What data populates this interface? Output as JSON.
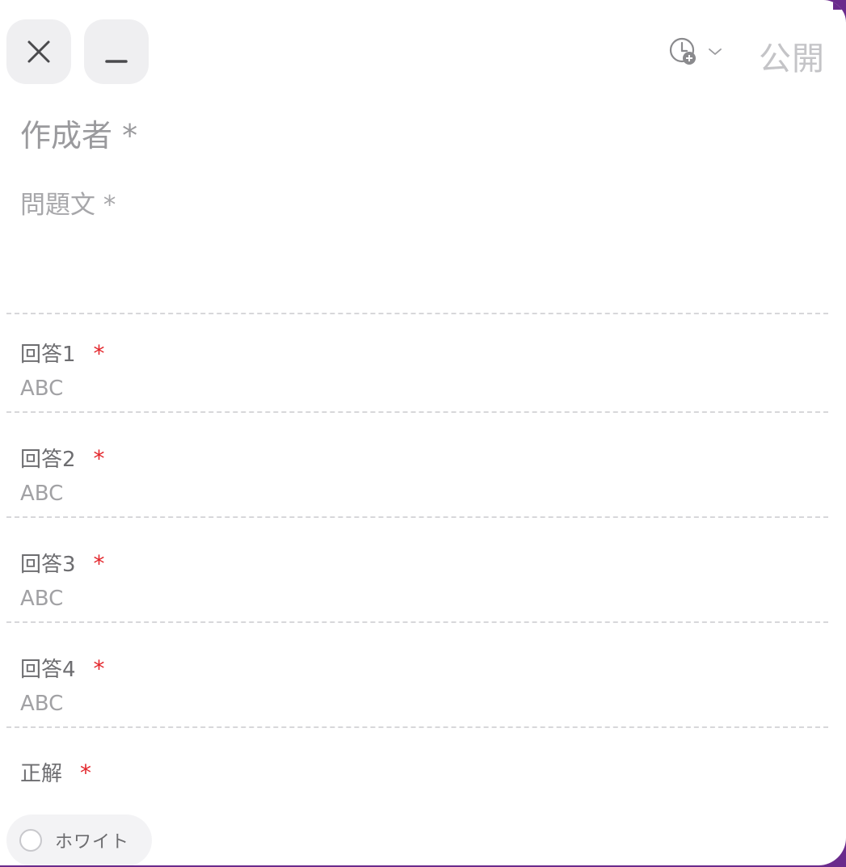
{
  "header": {
    "close_icon": "close-icon",
    "minimize_icon": "minimize-icon",
    "schedule_icon": "clock-add-icon",
    "schedule_dropdown_icon": "chevron-down-icon",
    "publish_label": "公開"
  },
  "form": {
    "author_placeholder": "作成者 *",
    "question_placeholder": "問題文 *",
    "answers": [
      {
        "label": "回答1",
        "required_mark": "*",
        "value": "ABC"
      },
      {
        "label": "回答2",
        "required_mark": "*",
        "value": "ABC"
      },
      {
        "label": "回答3",
        "required_mark": "*",
        "value": "ABC"
      },
      {
        "label": "回答4",
        "required_mark": "*",
        "value": "ABC"
      }
    ],
    "correct": {
      "label": "正解",
      "required_mark": "*",
      "options": [
        {
          "label": "ホワイト",
          "selected": false
        }
      ]
    }
  },
  "colors": {
    "accent": "#6a2b8c",
    "required": "#e3262c",
    "button_bg": "#efeff1"
  }
}
